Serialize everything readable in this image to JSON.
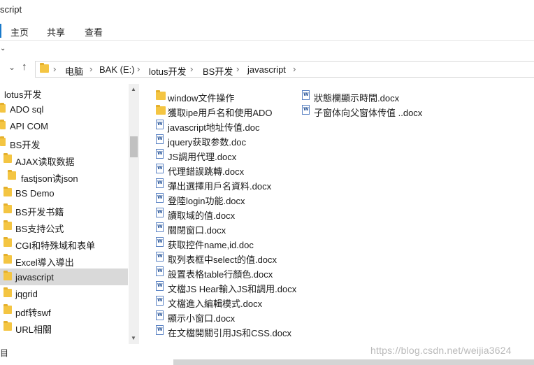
{
  "window": {
    "title": "script"
  },
  "ribbon": {
    "tabs": [
      "主页",
      "共享",
      "查看"
    ]
  },
  "nav": {
    "back_glyph": "‹",
    "down_glyph": "⌄",
    "up_glyph": "↑",
    "breadcrumbs": [
      "电脑",
      "BAK (E:)",
      "lotus开发",
      "BS开发",
      "javascript"
    ]
  },
  "tree": [
    {
      "label": "lotus开发",
      "icon": "none",
      "indent": 0
    },
    {
      "label": "ADO sql",
      "icon": "folder",
      "indent": 1
    },
    {
      "label": "API COM",
      "icon": "folder",
      "indent": 1
    },
    {
      "label": "BS开发",
      "icon": "folder",
      "indent": 1
    },
    {
      "label": "AJAX读取数据",
      "icon": "folder",
      "indent": 2
    },
    {
      "label": "fastjson读json",
      "icon": "folder",
      "indent": 3
    },
    {
      "label": "BS Demo",
      "icon": "folder",
      "indent": 2
    },
    {
      "label": "BS开发书籍",
      "icon": "folder",
      "indent": 2
    },
    {
      "label": "BS支持公式",
      "icon": "folder",
      "indent": 2
    },
    {
      "label": "CGI和特殊域和表单",
      "icon": "folder",
      "indent": 2
    },
    {
      "label": "Excel導入導出",
      "icon": "folder",
      "indent": 2
    },
    {
      "label": "javascript",
      "icon": "folder",
      "indent": 2,
      "selected": true
    },
    {
      "label": "jqgrid",
      "icon": "folder",
      "indent": 2
    },
    {
      "label": "pdf转swf",
      "icon": "folder",
      "indent": 2
    },
    {
      "label": "URL相關",
      "icon": "folder",
      "indent": 2
    }
  ],
  "files_col1": [
    {
      "name": "window文件操作",
      "type": "folder"
    },
    {
      "name": "獲取ipe用戶名和使用ADO",
      "type": "folder"
    },
    {
      "name": "javascript地址传值.doc",
      "type": "doc"
    },
    {
      "name": "jquery获取参数.doc",
      "type": "doc"
    },
    {
      "name": "JS調用代理.docx",
      "type": "doc"
    },
    {
      "name": "代理錯誤跳轉.docx",
      "type": "doc"
    },
    {
      "name": "彈出選擇用戶名資料.docx",
      "type": "doc"
    },
    {
      "name": "登陸login功能.docx",
      "type": "doc"
    },
    {
      "name": "讀取域的值.docx",
      "type": "doc"
    },
    {
      "name": "關閉窗口.docx",
      "type": "doc"
    },
    {
      "name": "获取控件name,id.doc",
      "type": "doc"
    },
    {
      "name": "取列表框中select的值.docx",
      "type": "doc"
    },
    {
      "name": "設置表格table行顏色.docx",
      "type": "doc"
    },
    {
      "name": "文檔JS Hear輸入JS和調用.docx",
      "type": "doc"
    },
    {
      "name": "文檔進入編輯模式.docx",
      "type": "doc"
    },
    {
      "name": "顯示小窗口.docx",
      "type": "doc"
    },
    {
      "name": "在文檔開關引用JS和CSS.docx",
      "type": "doc"
    }
  ],
  "files_col2": [
    {
      "name": "狀態欄顯示時間.docx",
      "type": "doc"
    },
    {
      "name": "子窗体向父窗体传值 ..docx",
      "type": "doc"
    }
  ],
  "status": {
    "left": "目"
  },
  "watermark": "https://blog.csdn.net/weijia3624"
}
